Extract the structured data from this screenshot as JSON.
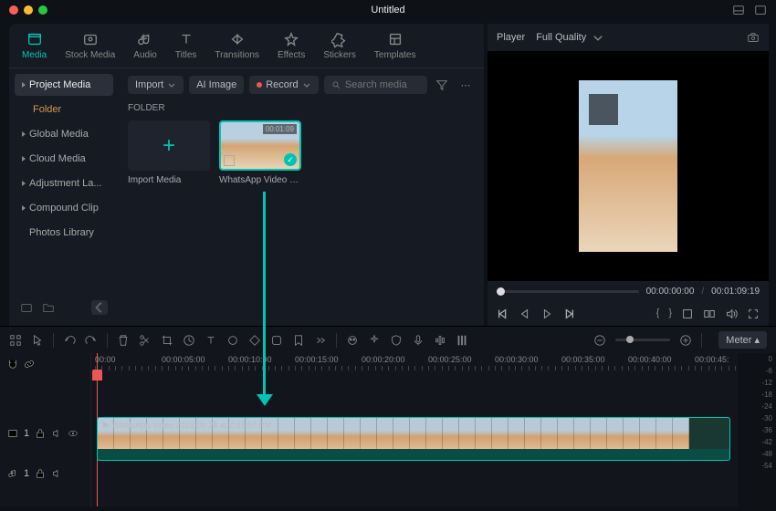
{
  "title": "Untitled",
  "tabs": [
    "Media",
    "Stock Media",
    "Audio",
    "Titles",
    "Transitions",
    "Effects",
    "Stickers",
    "Templates"
  ],
  "sidebar": {
    "project": "Project Media",
    "folder": "Folder",
    "items": [
      "Global Media",
      "Cloud Media",
      "Adjustment La...",
      "Compound Clip",
      "Photos Library"
    ]
  },
  "toolbar": {
    "import": "Import",
    "ai_image": "AI Image",
    "record": "Record",
    "search_ph": "Search media"
  },
  "folder_label": "FOLDER",
  "thumbs": {
    "import": "Import Media",
    "clip_dur": "00:01:09",
    "clip_name": "WhatsApp Video 202…"
  },
  "player": {
    "label": "Player",
    "quality": "Full Quality",
    "current": "00:00:00:00",
    "total": "00:01:09:19"
  },
  "timeline": {
    "marks": [
      "00:00",
      "00:00:05:00",
      "00:00:10:00",
      "00:00:15:00",
      "00:00:20:00",
      "00:00:25:00",
      "00:00:30:00",
      "00:00:35:00",
      "00:00:40:00",
      "00:00:45:"
    ],
    "clip_label": "WhatsApp Video 2023-09-28 at 2.07.57 PM",
    "meter": "Meter",
    "db": [
      "0",
      "-6",
      "-12",
      "-18",
      "-24",
      "-30",
      "-36",
      "-42",
      "-48",
      "-54"
    ],
    "v_label": "1",
    "a_label": "1"
  }
}
